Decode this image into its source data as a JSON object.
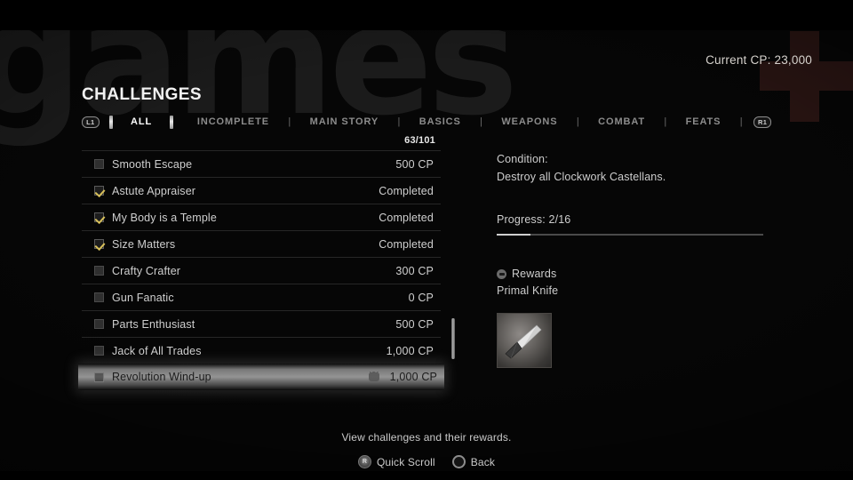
{
  "background": {
    "watermark_text": "games",
    "cross_color": "#2a1513"
  },
  "header": {
    "cp_label": "Current CP: 23,000",
    "title": "CHALLENGES"
  },
  "tabbar": {
    "left_bumper": "L1",
    "right_bumper": "R1",
    "separator": "|",
    "tabs": [
      {
        "label": "ALL",
        "active": true
      },
      {
        "label": "INCOMPLETE",
        "active": false
      },
      {
        "label": "MAIN STORY",
        "active": false
      },
      {
        "label": "BASICS",
        "active": false
      },
      {
        "label": "WEAPONS",
        "active": false
      },
      {
        "label": "COMBAT",
        "active": false
      },
      {
        "label": "FEATS",
        "active": false
      }
    ]
  },
  "list": {
    "count": "63/101",
    "rows": [
      {
        "name": "Smooth Escape",
        "value": "500 CP",
        "checked": false,
        "selected": false,
        "trophy": false
      },
      {
        "name": "Astute Appraiser",
        "value": "Completed",
        "checked": true,
        "selected": false,
        "trophy": false
      },
      {
        "name": "My Body is a Temple",
        "value": "Completed",
        "checked": true,
        "selected": false,
        "trophy": false
      },
      {
        "name": "Size Matters",
        "value": "Completed",
        "checked": true,
        "selected": false,
        "trophy": false
      },
      {
        "name": "Crafty Crafter",
        "value": "300 CP",
        "checked": false,
        "selected": false,
        "trophy": false
      },
      {
        "name": "Gun Fanatic",
        "value": "0 CP",
        "checked": false,
        "selected": false,
        "trophy": false
      },
      {
        "name": "Parts Enthusiast",
        "value": "500 CP",
        "checked": false,
        "selected": false,
        "trophy": false
      },
      {
        "name": "Jack of All Trades",
        "value": "1,000 CP",
        "checked": false,
        "selected": false,
        "trophy": false
      },
      {
        "name": "Revolution Wind-up",
        "value": "1,000 CP",
        "checked": false,
        "selected": true,
        "trophy": true
      }
    ]
  },
  "detail": {
    "condition_label": "Condition:",
    "condition_text": "Destroy all Clockwork Castellans.",
    "progress_label": "Progress: 2/16",
    "progress_current": 2,
    "progress_total": 16,
    "progress_percent": 12.5,
    "rewards_title": "Rewards",
    "reward_item": "Primal Knife",
    "reward_icon": "knife-icon"
  },
  "footer": {
    "hint": "View challenges and their rewards.",
    "buttons": [
      {
        "glyph": "R",
        "icon": "analog-stick-icon",
        "label": "Quick Scroll"
      },
      {
        "glyph": "",
        "icon": "circle-button-icon",
        "label": "Back"
      }
    ]
  }
}
